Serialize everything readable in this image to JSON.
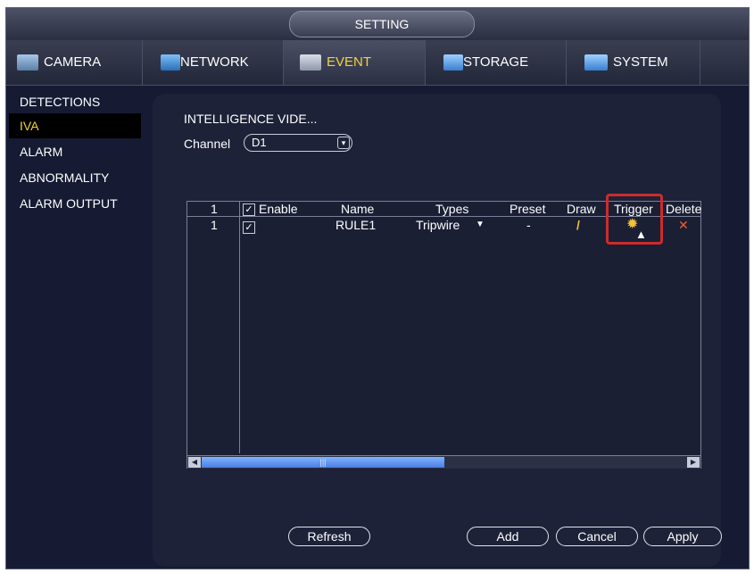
{
  "window": {
    "title": "SETTING"
  },
  "tabs": [
    {
      "label": "CAMERA",
      "icon": "camera-icon"
    },
    {
      "label": "NETWORK",
      "icon": "network-icon"
    },
    {
      "label": "EVENT",
      "icon": "event-icon"
    },
    {
      "label": "STORAGE",
      "icon": "storage-icon"
    },
    {
      "label": "SYSTEM",
      "icon": "system-icon"
    }
  ],
  "sidebar": {
    "items": [
      {
        "label": "DETECTIONS"
      },
      {
        "label": "IVA"
      },
      {
        "label": "ALARM"
      },
      {
        "label": "ABNORMALITY"
      },
      {
        "label": "ALARM OUTPUT"
      }
    ]
  },
  "main": {
    "section_title": "INTELLIGENCE VIDE...",
    "channel": {
      "label": "Channel",
      "value": "D1"
    },
    "table": {
      "headers": {
        "index": "1",
        "enable": "Enable",
        "name": "Name",
        "types": "Types",
        "preset": "Preset",
        "draw": "Draw",
        "trigger": "Trigger",
        "delete": "Delete"
      },
      "rows": [
        {
          "index": "1",
          "enabled": true,
          "name": "RULE1",
          "type": "Tripwire",
          "preset": "-",
          "draw_icon": "pencil-icon",
          "trigger_icon": "gear-icon",
          "delete_icon": "close-icon"
        }
      ]
    },
    "buttons": {
      "refresh": "Refresh",
      "add": "Add",
      "cancel": "Cancel",
      "apply": "Apply"
    }
  },
  "colors": {
    "accent": "#f3d23a",
    "background": "#161b33",
    "panel": "#1d2238",
    "highlight": "#cc2b2b"
  }
}
